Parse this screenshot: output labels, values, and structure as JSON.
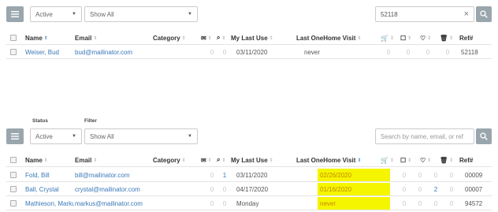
{
  "top": {
    "status_value": "Active",
    "filter_value": "Show All",
    "search_value": "52118",
    "clear_symbol": "×",
    "columns": {
      "name": "Name",
      "email": "Email",
      "category": "Category",
      "my_last_use": "My Last Use",
      "last_visit": "Last OneHome Visit",
      "ref": "Ref#"
    },
    "rows": [
      {
        "name": "Weiser, Bud",
        "email": "bud@mailinator.com",
        "c1": "0",
        "c2": "0",
        "last_use": "03/11/2020",
        "last_visit": "never",
        "c3": "0",
        "c4": "0",
        "c5": "0",
        "c6": "0",
        "ref": "52118"
      }
    ]
  },
  "bottom": {
    "status_label": "Status",
    "filter_label": "Filter",
    "status_value": "Active",
    "filter_value": "Show All",
    "search_placeholder": "Search by name, email, or ref",
    "columns": {
      "name": "Name",
      "email": "Email",
      "category": "Category",
      "my_last_use": "My Last Use",
      "last_visit": "Last OneHome Visit",
      "ref": "Ref#"
    },
    "rows": [
      {
        "name": "Fold, Bill",
        "email": "bill@mailinator.com",
        "c1": "0",
        "c2": "1",
        "last_use": "03/11/2020",
        "last_visit": "02/26/2020",
        "c3": "0",
        "c4": "0",
        "c5": "0",
        "c6": "0",
        "ref": "00009"
      },
      {
        "name": "Ball, Crystal",
        "email": "crystal@mailinator.com",
        "c1": "0",
        "c2": "0",
        "last_use": "04/17/2020",
        "last_visit": "01/16/2020",
        "c3": "0",
        "c4": "0",
        "c5": "2",
        "c6": "0",
        "ref": "00007"
      },
      {
        "name": "Mathieson, Markus",
        "email": "markus@mailinator.com",
        "c1": "0",
        "c2": "0",
        "last_use": "Monday",
        "last_visit": "never",
        "c3": "0",
        "c4": "0",
        "c5": "0",
        "c6": "0",
        "ref": "94572"
      }
    ]
  },
  "colors": {
    "highlight": "#f5f500",
    "link": "#3a78b8",
    "button": "#9aa6ad"
  },
  "icons": [
    "list-icon",
    "search-icon",
    "email-icon",
    "search-count-icon",
    "cart-icon",
    "comment-icon",
    "heart-icon",
    "trash-icon",
    "checkbox-icon",
    "sort-icon"
  ]
}
